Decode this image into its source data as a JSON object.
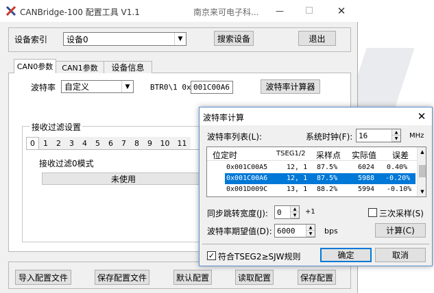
{
  "main_window": {
    "title": "CANBridge-100 配置工具 V1.1",
    "company": "南京来可电子科...",
    "device_index_label": "设备索引",
    "device_value": "设备0",
    "search_button": "搜索设备",
    "exit_button": "退出",
    "tabs": [
      {
        "label": "CAN0参数",
        "active": true
      },
      {
        "label": "CAN1参数",
        "active": false
      },
      {
        "label": "设备信息",
        "active": false
      }
    ],
    "baud_label": "波特率",
    "baud_value": "自定义",
    "btr_label": "BTR0\\1 0x",
    "btr_value": "001C00A6",
    "baud_calc_button": "波特率计算器",
    "filter_group_label": "接收过滤设置",
    "filter_tabs": [
      "0",
      "1",
      "2",
      "3",
      "4",
      "5",
      "6",
      "7",
      "8",
      "9",
      "10",
      "11"
    ],
    "filter_mode_label": "接收过滤0模式",
    "filter_mode_value": "未使用",
    "bottom_buttons": [
      "导入配置文件",
      "保存配置文件",
      "默认配置",
      "读取配置",
      "保存配置"
    ]
  },
  "dialog": {
    "title": "波特率计算",
    "list_label": "波特率列表(L):",
    "clock_label": "系统时钟(F):",
    "clock_value": "16",
    "clock_unit": "MHz",
    "columns": [
      "位定时",
      "TSEG1/2",
      "采样点",
      "实际值",
      "误差"
    ],
    "rows": [
      {
        "timing": "0x001C00A5",
        "tseg": "12, 1",
        "sample": "87.5%",
        "actual": "6024",
        "error": "0.40%",
        "selected": false
      },
      {
        "timing": "0x001C00A6",
        "tseg": "12, 1",
        "sample": "87.5%",
        "actual": "5988",
        "error": "-0.20%",
        "selected": true
      },
      {
        "timing": "0x001D009C",
        "tseg": "13, 1",
        "sample": "88.2%",
        "actual": "5994",
        "error": "-0.10%",
        "selected": false
      }
    ],
    "sjw_label": "同步跳转宽度(J):",
    "sjw_value": "0",
    "sjw_suffix": "+1",
    "triple_label": "三次采样(S)",
    "expected_label": "波特率期望值(D):",
    "expected_value": "6000",
    "expected_unit": "bps",
    "calc_button": "计算(C)",
    "rule_label": "符合TSEG2≥SJW规则",
    "ok_button": "确定",
    "cancel_button": "取消"
  },
  "colors": {
    "selection": "#0078d7",
    "window_bg": "#f0f0f0",
    "accent_border": "#0078d7"
  }
}
